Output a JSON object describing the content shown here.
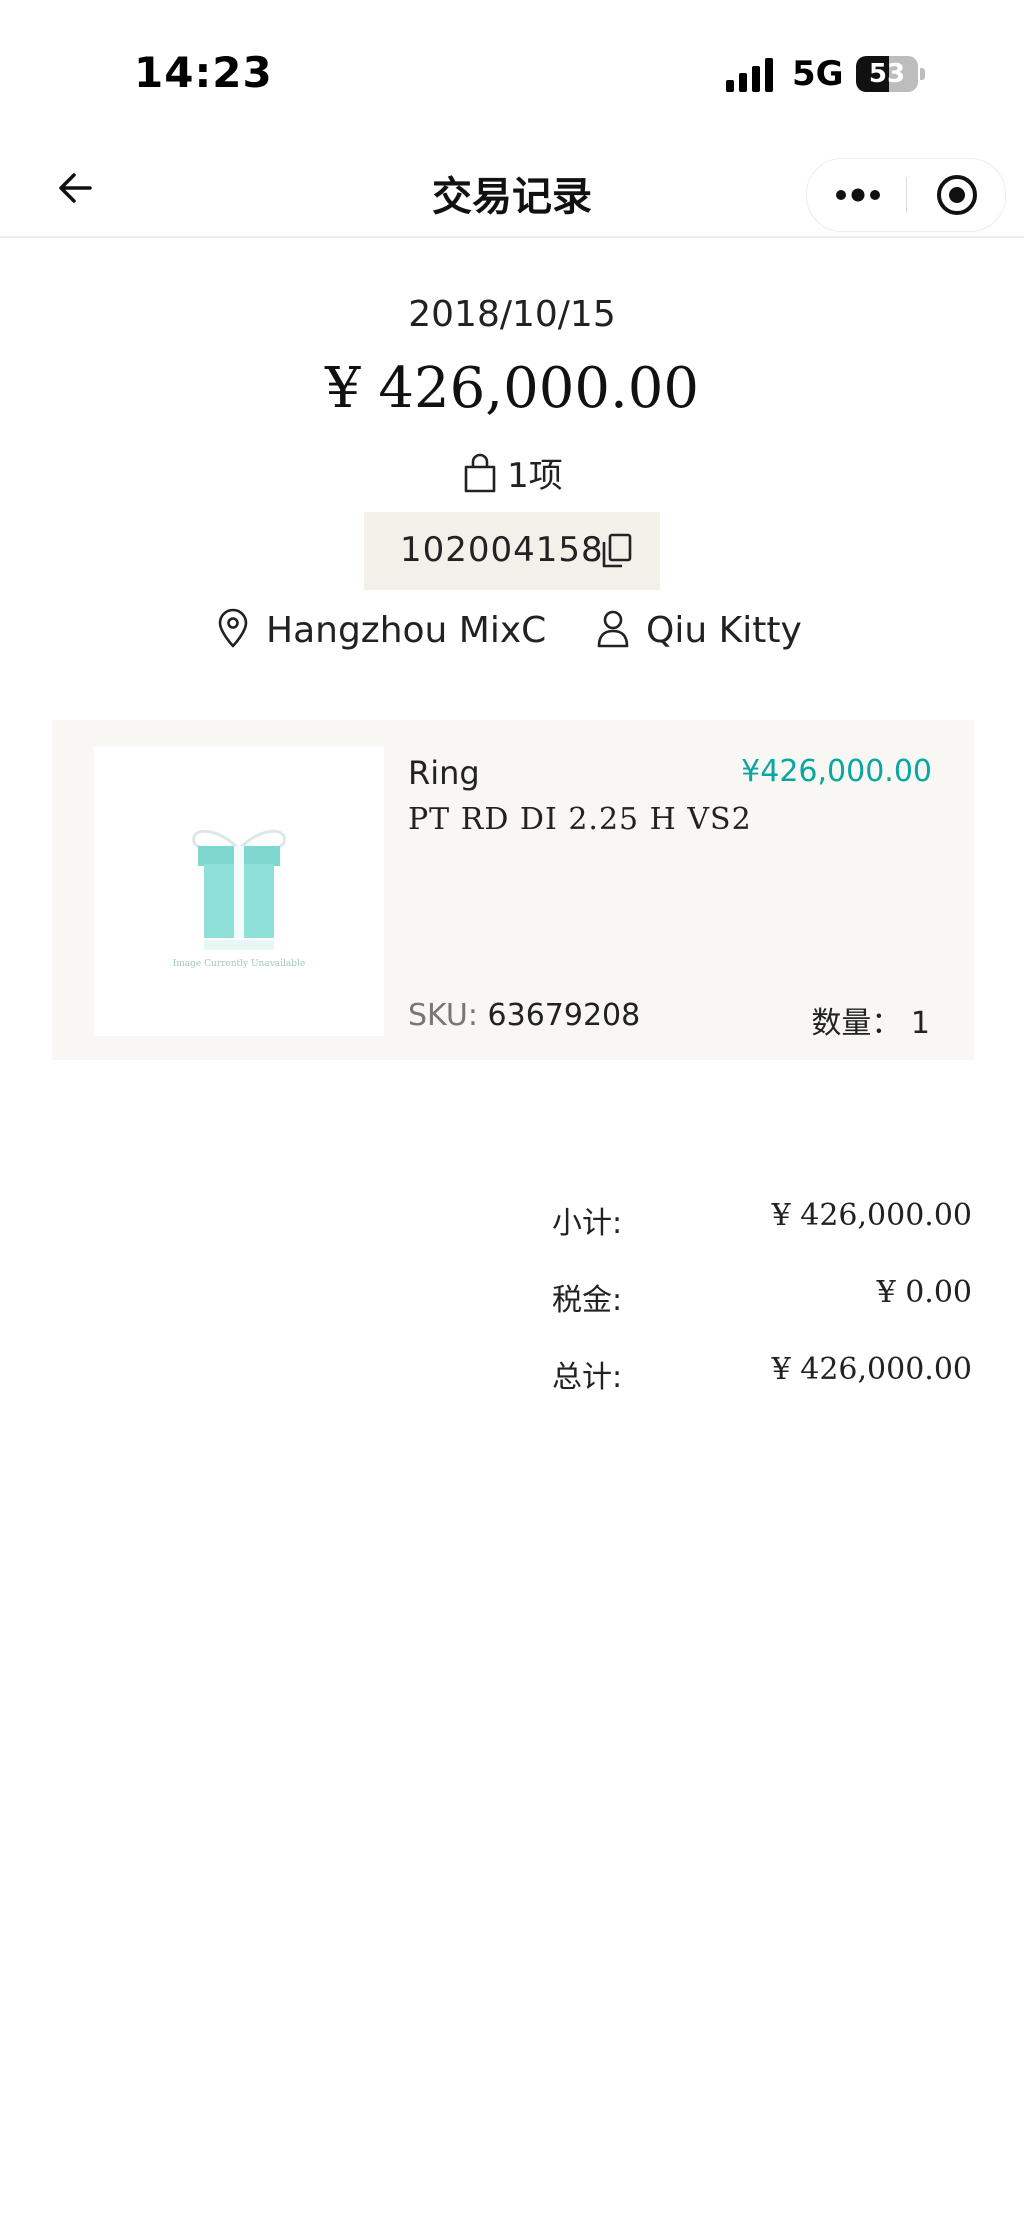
{
  "status_bar": {
    "time": "14:23",
    "network": "5G",
    "battery_level": "53",
    "battery_fraction": 0.53
  },
  "nav": {
    "title": "交易记录",
    "back_icon": "arrow-left-icon",
    "more_icon": "more-dots-icon",
    "target_icon": "target-icon"
  },
  "summary": {
    "date": "2018/10/15",
    "total": "¥ 426,000.00",
    "item_count": "1项",
    "order_number": "102004158",
    "location": "Hangzhou MixC",
    "staff": "Qiu Kitty"
  },
  "product": {
    "name": "Ring",
    "price": "¥426,000.00",
    "description": "PT RD DI 2.25 H VS2",
    "sku_label": "SKU:",
    "sku_value": "63679208",
    "qty": "数量： 1",
    "image_caption": "Image Currently Unavailable",
    "accent_color": "#0aa6a0"
  },
  "totals": {
    "subtotal_label": "小计:",
    "subtotal_value": "¥ 426,000.00",
    "tax_label": "税金:",
    "tax_value": "¥ 0.00",
    "grand_label": "总计:",
    "grand_value": "¥ 426,000.00"
  }
}
